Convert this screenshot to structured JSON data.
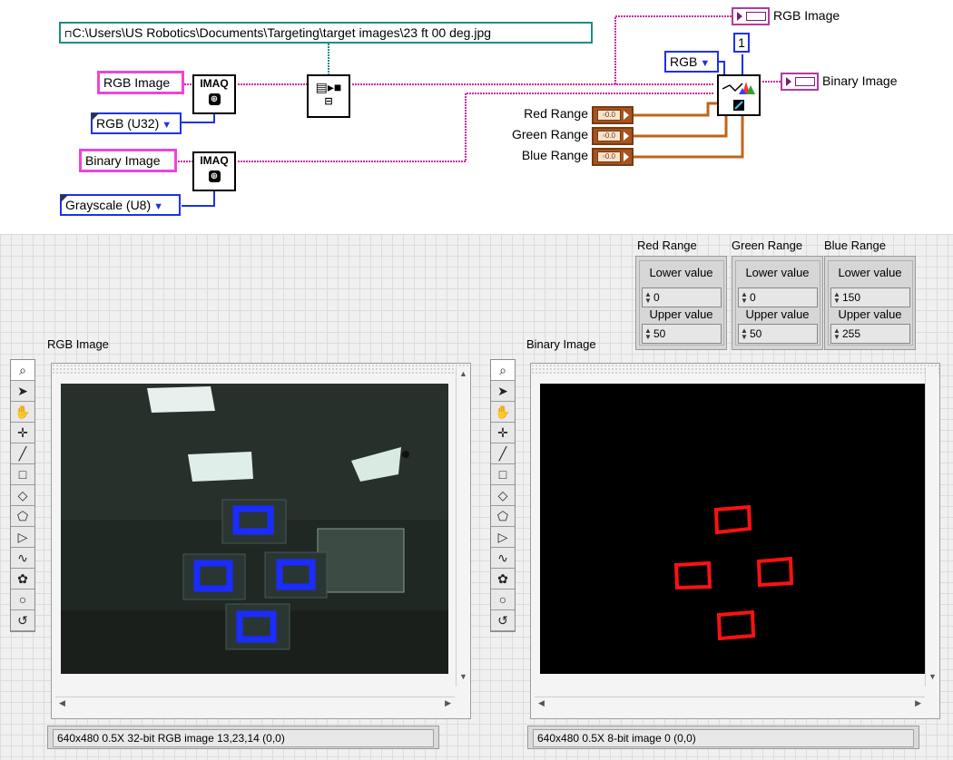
{
  "diagram": {
    "file_path": "C:\\Users\\US Robotics\\Documents\\Targeting\\target images\\23 ft 00 deg.jpg",
    "rgb_image_control": "RGB Image",
    "binary_image_control": "Binary Image",
    "rgb_type": "RGB (U32)",
    "gray_type": "Grayscale (U8)",
    "imaq_label": "IMAQ",
    "color_mode": "RGB",
    "replace_value": "1",
    "red_range": "Red Range",
    "green_range": "Green Range",
    "blue_range": "Blue Range",
    "out_rgb_image": "RGB Image",
    "out_binary_image": "Binary Image"
  },
  "panel": {
    "ranges": [
      {
        "title": "Red Range",
        "lower_label": "Lower value",
        "lower": "0",
        "upper_label": "Upper value",
        "upper": "50"
      },
      {
        "title": "Green Range",
        "lower_label": "Lower value",
        "lower": "0",
        "upper_label": "Upper value",
        "upper": "50"
      },
      {
        "title": "Blue Range",
        "lower_label": "Lower value",
        "lower": "150",
        "upper_label": "Upper value",
        "upper": "255"
      }
    ],
    "rgb_display": {
      "label": "RGB Image",
      "info": "640x480 0.5X 32-bit RGB image 13,23,14     (0,0)"
    },
    "binary_display": {
      "label": "Binary Image",
      "info": "640x480 0.5X 8-bit image 0     (0,0)"
    },
    "tools": [
      "zoom-icon",
      "pointer-icon",
      "pan-icon",
      "crosshair-icon",
      "line-icon",
      "rectangle-icon",
      "rotated-rectangle-icon",
      "polygon-icon",
      "freehand-region-icon",
      "freehand-line-icon",
      "annulus-icon",
      "oval-icon",
      "broken-line-icon"
    ]
  },
  "colors": {
    "wire_pink": "#cc2c9e",
    "wire_orange": "#c0641c",
    "wire_blue": "#1d32e8",
    "wire_teal": "#1f8c86",
    "target_blue": "#1a2cff",
    "binary_red": "#ff1111"
  }
}
